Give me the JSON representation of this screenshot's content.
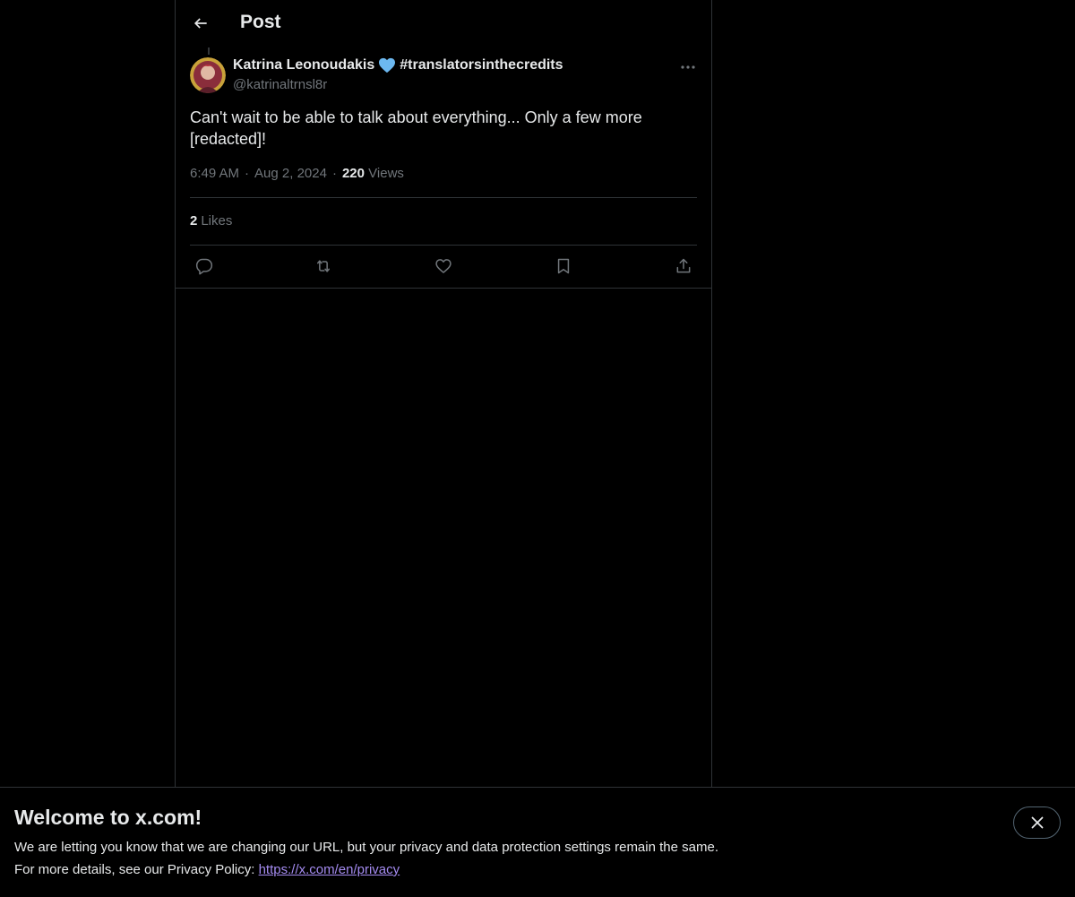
{
  "header": {
    "title": "Post",
    "back_icon": "arrow-left-icon"
  },
  "post": {
    "author_name": "Katrina Leonoudakis",
    "author_badge_icon": "blue-heart-icon",
    "author_hashtag": "#translatorsinthecredits",
    "handle": "@katrinaltrnsl8r",
    "text": "Can't wait to be able to talk about everything... Only a few more [redacted]!",
    "time": "6:49 AM",
    "separator": "·",
    "date": "Aug 2, 2024",
    "views_count": "220",
    "views_label": "Views",
    "likes_count": "2",
    "likes_label": "Likes"
  },
  "actions": [
    {
      "icon": "reply-icon"
    },
    {
      "icon": "repost-icon"
    },
    {
      "icon": "like-icon"
    },
    {
      "icon": "bookmark-icon"
    },
    {
      "icon": "share-icon"
    }
  ],
  "banner": {
    "title": "Welcome to x.com!",
    "line1": "We are letting you know that we are changing our URL, but your privacy and data protection settings remain the same.",
    "line2_prefix": "For more details, see our Privacy Policy: ",
    "link": "https://x.com/en/privacy",
    "close_icon": "close-icon"
  },
  "colors": {
    "background": "#000000",
    "text_primary": "#e7e9ea",
    "text_secondary": "#71767b",
    "border": "#2f3336",
    "heart_badge": "#6cb8f0",
    "link": "#a48bf0"
  }
}
